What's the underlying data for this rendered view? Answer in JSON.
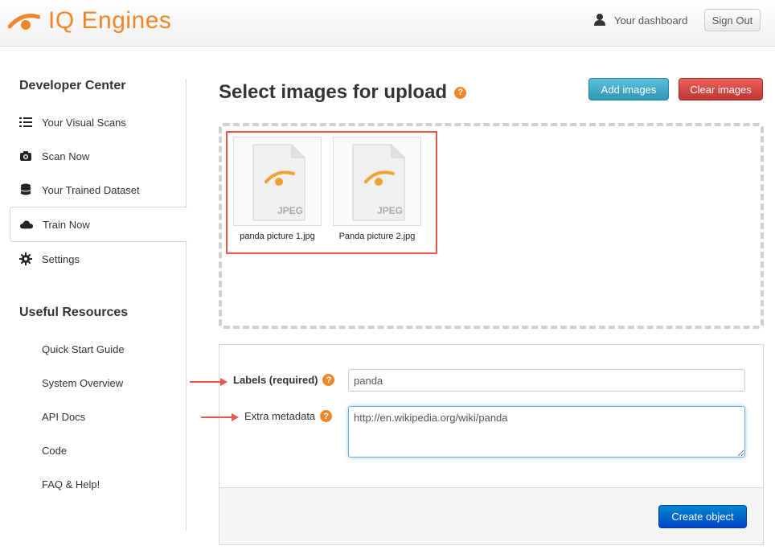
{
  "header": {
    "brand": "IQ Engines",
    "dashboard_link": "Your dashboard",
    "sign_out": "Sign Out",
    "brand_color": "#f0862a"
  },
  "sidebar": {
    "developer_heading": "Developer Center",
    "items": [
      {
        "label": "Your Visual Scans",
        "icon": "list-icon"
      },
      {
        "label": "Scan Now",
        "icon": "camera-icon"
      },
      {
        "label": "Your Trained Dataset",
        "icon": "database-icon"
      },
      {
        "label": "Train Now",
        "icon": "cloud-icon",
        "active": true
      },
      {
        "label": "Settings",
        "icon": "gear-icon"
      }
    ],
    "resources_heading": "Useful Resources",
    "resources": [
      "Quick Start Guide",
      "System Overview",
      "API Docs",
      "Code",
      "FAQ & Help!"
    ]
  },
  "main": {
    "title": "Select images for upload",
    "help": "?",
    "add_images": "Add images",
    "clear_images": "Clear images",
    "files": [
      {
        "name": "panda picture 1.jpg",
        "type": "JPEG"
      },
      {
        "name": "Panda picture 2.jpg",
        "type": "JPEG"
      }
    ],
    "form": {
      "labels_label": "Labels (required)",
      "labels_value": "panda",
      "metadata_label": "Extra metadata",
      "metadata_value": "http://en.wikipedia.org/wiki/panda",
      "create_button": "Create object"
    }
  }
}
